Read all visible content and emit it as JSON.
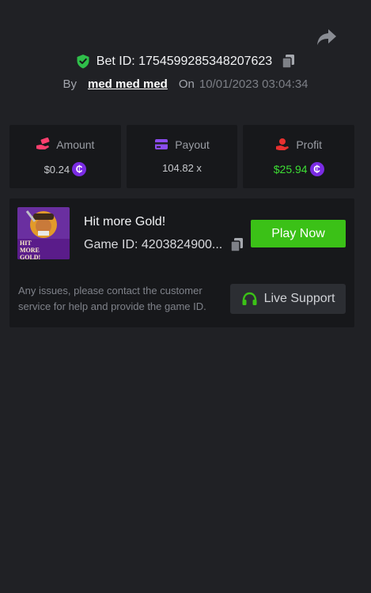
{
  "header": {
    "share_icon": "share-arrow-icon",
    "bet_id_label": "Bet ID: 1754599285348207623",
    "by_label": "By",
    "username": "med med med",
    "on_label": "On",
    "datetime": "10/01/2023 03:04:34"
  },
  "stats": {
    "amount": {
      "label": "Amount",
      "value": "$0.24",
      "icon": "money-hand-icon"
    },
    "payout": {
      "label": "Payout",
      "value": "104.82 x",
      "icon": "card-icon"
    },
    "profit": {
      "label": "Profit",
      "value": "$25.94",
      "icon": "profit-hand-icon"
    },
    "coin_glyph": "₵"
  },
  "game": {
    "title": "Hit more Gold!",
    "game_id": "Game ID: 4203824900...",
    "thumb_text": "HIT MORE GOLD!",
    "play_label": "Play Now",
    "notice": "Any issues, please contact the customer service for help and provide the game ID.",
    "support_label": "Live Support"
  },
  "colors": {
    "background": "#202125",
    "card": "#17181b",
    "play_button": "#3bc117",
    "profit_green": "#3dde34",
    "coin_purple": "#7a2be4",
    "shield_green": "#2fbf4a"
  }
}
